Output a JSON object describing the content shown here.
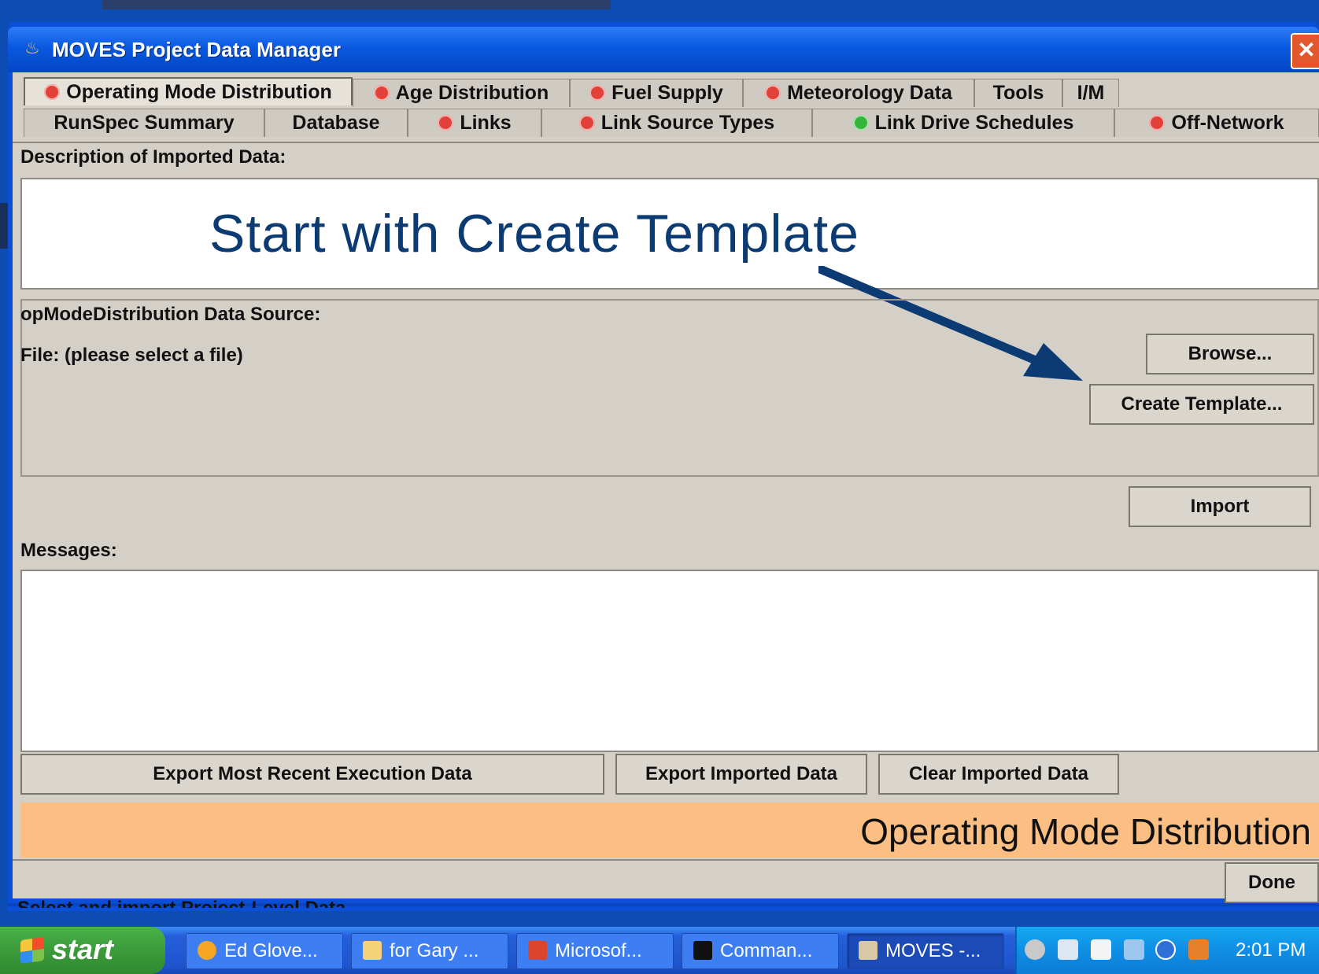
{
  "window": {
    "title": "MOVES Project Data Manager"
  },
  "tabs_row1": [
    {
      "label": "Operating Mode Distribution",
      "icon": "error-icon",
      "active": true
    },
    {
      "label": "Age Distribution",
      "icon": "error-icon"
    },
    {
      "label": "Fuel Supply",
      "icon": "error-icon"
    },
    {
      "label": "Meteorology Data",
      "icon": "error-icon"
    },
    {
      "label": "Tools",
      "icon": ""
    },
    {
      "label": "I/M",
      "icon": ""
    }
  ],
  "tabs_row2": [
    {
      "label": "RunSpec Summary",
      "icon": ""
    },
    {
      "label": "Database",
      "icon": ""
    },
    {
      "label": "Links",
      "icon": "error-icon"
    },
    {
      "label": "Link Source Types",
      "icon": "error-icon"
    },
    {
      "label": "Link Drive Schedules",
      "icon": "check-icon"
    },
    {
      "label": "Off-Network",
      "icon": "error-icon"
    }
  ],
  "description": {
    "label": "Description of Imported Data:",
    "value": ""
  },
  "annotation": {
    "text": "Start with Create Template"
  },
  "data_source": {
    "label": "opModeDistribution Data Source:",
    "file_label": "File: (please select a file)",
    "browse_label": "Browse...",
    "create_template_label": "Create Template..."
  },
  "import_label": "Import",
  "messages": {
    "label": "Messages:",
    "value": ""
  },
  "buttons": {
    "export_recent": "Export Most Recent Execution Data",
    "export_imported": "Export Imported Data",
    "clear_imported": "Clear Imported Data",
    "done": "Done"
  },
  "section_banner": "Operating Mode Distribution",
  "status_text": "Select and import Project-Level Data",
  "taskbar": {
    "start_label": "start",
    "tasks": [
      {
        "label": "Ed Glove...",
        "icon": "browser-icon"
      },
      {
        "label": "for Gary ...",
        "icon": "folder-icon"
      },
      {
        "label": "Microsof...",
        "icon": "powerpoint-icon"
      },
      {
        "label": "Comman...",
        "icon": "console-icon"
      },
      {
        "label": "MOVES -...",
        "icon": "java-icon",
        "active": true
      }
    ],
    "clock": "2:01 PM"
  },
  "colors": {
    "title_blue": "#0a58e0",
    "banner_orange": "#fbbe83",
    "annotation_blue": "#0c3b73",
    "error_red": "#e2413a",
    "ok_green": "#35b43a"
  }
}
